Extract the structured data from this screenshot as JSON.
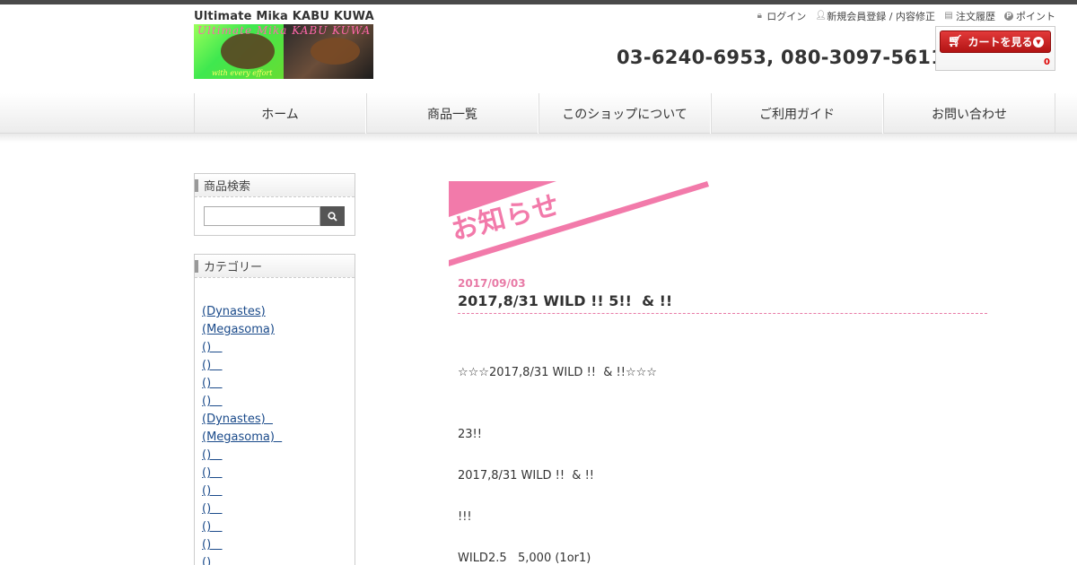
{
  "header": {
    "shop_name": "Ultimate Mika KABU KUWA",
    "logo_text": "Ultimate Mika KABU KUWA",
    "logo_sub": "with every effort",
    "phone": "03-6240-6953, 080-3097-5611"
  },
  "util_nav": {
    "login": "ログイン",
    "register": "新規会員登録 / 内容修正",
    "order_history": "注文履歴",
    "points": "ポイント"
  },
  "cart": {
    "label": "カートを見る",
    "count": "0"
  },
  "global_nav": {
    "items": [
      "ホーム",
      "商品一覧",
      "このショップについて",
      "ご利用ガイド",
      "お問い合わせ"
    ]
  },
  "sidebar": {
    "search_title": "商品検索",
    "search_placeholder": "",
    "category_title": "カテゴリー",
    "categories": [
      "(Dynastes)",
      "(Megasoma)",
      "()   ",
      "()   ",
      "()   ",
      "()   ",
      "(Dynastes)  ",
      "(Megasoma)  ",
      "()   ",
      "()   ",
      "()   ",
      "()   ",
      "()   ",
      "()   ",
      "()"
    ]
  },
  "main": {
    "section_heading": "お知らせ",
    "post_date": "2017/09/03",
    "post_title": "2017,8/31 WILD !! 5!!  & !!",
    "paragraphs": [
      "☆☆☆2017,8/31 WILD !!  & !!☆☆☆",
      "23!!",
      "2017,8/31 WILD !!  & !!",
      "!!!",
      "WILD2.5   5,000 (1or1)"
    ]
  },
  "colors": {
    "accent_pink": "#f27aaa",
    "cart_red": "#c11414",
    "link_blue": "#1a4a8a"
  }
}
